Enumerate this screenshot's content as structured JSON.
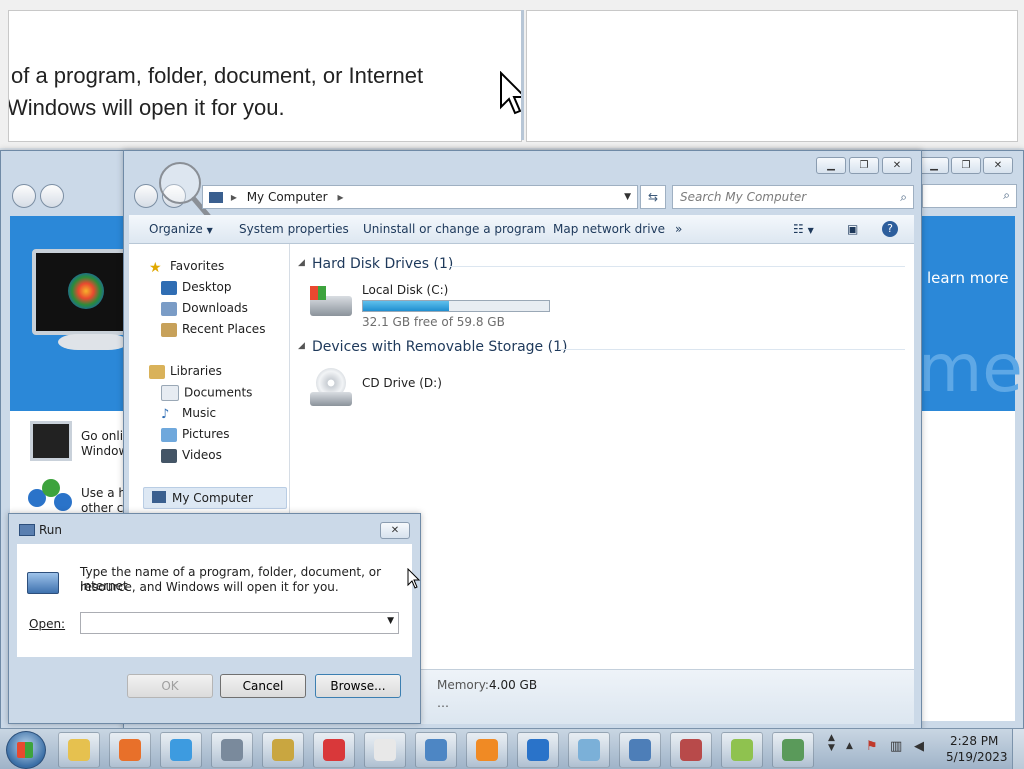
{
  "magnifier": {
    "line1": "of a program, folder, document, or Internet",
    "line2": "Windows will open it for you."
  },
  "bg_window": {
    "learn_more": "learn more",
    "big_text": "me",
    "item1_line1": "Go onli",
    "item1_line2": "Window",
    "item2_line1": "Use a ho",
    "item2_line2": "other co"
  },
  "explorer": {
    "address_location": "My Computer",
    "search_placeholder": "Search My Computer",
    "toolbar": {
      "organize": "Organize",
      "system_properties": "System properties",
      "uninstall": "Uninstall or change a program",
      "map_drive": "Map network drive",
      "more": "»"
    },
    "nav": {
      "favorites": "Favorites",
      "desktop": "Desktop",
      "downloads": "Downloads",
      "recent": "Recent Places",
      "libraries": "Libraries",
      "documents": "Documents",
      "music": "Music",
      "pictures": "Pictures",
      "videos": "Videos",
      "computer": "My Computer"
    },
    "groups": {
      "hdd": "Hard Disk Drives (1)",
      "removable": "Devices with Removable Storage (1)"
    },
    "drives": {
      "c_name": "Local Disk (C:)",
      "c_free": "32.1 GB free of 59.8 GB",
      "c_used_fraction": 0.46,
      "d_name": "CD Drive (D:)"
    },
    "details": {
      "memory_label": "Memory:",
      "memory_value": "4.00 GB"
    }
  },
  "run_dialog": {
    "title": "Run",
    "description_line1": "Type the name of a program, folder, document, or Internet",
    "description_line2": "resource, and Windows will open it for you.",
    "open_label": "Open:",
    "open_value": "",
    "ok": "OK",
    "cancel": "Cancel",
    "browse": "Browse..."
  },
  "taskbar": {
    "time": "2:28 PM",
    "date": "5/19/2023",
    "apps": [
      "explorer-icon",
      "firefox-icon",
      "chrome-icon",
      "calculator-icon",
      "solitaire-king-icon",
      "hearts-icon",
      "spider-solitaire-icon",
      "remote-desktop-icon",
      "media-player-icon",
      "internet-explorer-icon",
      "paint-icon",
      "mail-icon",
      "snipping-tool-icon",
      "sticky-notes-icon",
      "notepad-icon"
    ]
  },
  "colors": {
    "accent_blue": "#2b88d8",
    "progress_fill": "#26a0da",
    "group_header": "#1e395b"
  }
}
